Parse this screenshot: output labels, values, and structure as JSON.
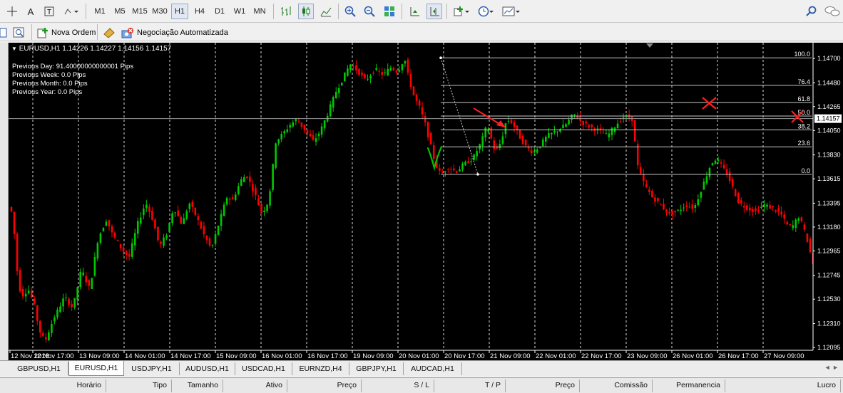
{
  "toolbar": {
    "timeframes": [
      "M1",
      "M5",
      "M15",
      "M30",
      "H1",
      "H4",
      "D1",
      "W1",
      "MN"
    ],
    "active_timeframe": "H1",
    "new_order_label": "Nova Ordem",
    "auto_trading_label": "Negociação Automatizada"
  },
  "chart": {
    "header": "EURUSD,H1  1.14226 1.14227 1.14156 1.14157",
    "info_lines": [
      "Previous Day: 91.40000000000001 Pips",
      "Previous Week: 0.0 Pips",
      "Previous Month: 0.0 Pips",
      "Previous Year: 0.0 Pips"
    ],
    "current_price": "1.14157"
  },
  "chart_data": {
    "type": "candlestick",
    "symbol": "EURUSD",
    "timeframe": "H1",
    "ohlc_current": {
      "open": 1.14226,
      "high": 1.14227,
      "low": 1.14156,
      "close": 1.14157
    },
    "y_ticks": [
      "1.14700",
      "1.14480",
      "1.14265",
      "1.14050",
      "1.13830",
      "1.13615",
      "1.13395",
      "1.13180",
      "1.12965",
      "1.12745",
      "1.12530",
      "1.12310",
      "1.12095"
    ],
    "ylim": [
      1.12095,
      1.147
    ],
    "x_ticks": [
      "12 Nov 2018",
      "12 Nov 17:00",
      "13 Nov 09:00",
      "14 Nov 01:00",
      "14 Nov 17:00",
      "15 Nov 09:00",
      "16 Nov 01:00",
      "16 Nov 17:00",
      "19 Nov 09:00",
      "20 Nov 01:00",
      "20 Nov 17:00",
      "21 Nov 09:00",
      "22 Nov 01:00",
      "22 Nov 17:00",
      "23 Nov 09:00",
      "26 Nov 01:00",
      "26 Nov 17:00",
      "27 Nov 09:00"
    ],
    "fibonacci": [
      {
        "level": "100.0",
        "price": 1.14705
      },
      {
        "level": "76.4",
        "price": 1.14457
      },
      {
        "level": "61.8",
        "price": 1.14303
      },
      {
        "level": "50.0",
        "price": 1.1418
      },
      {
        "level": "38.2",
        "price": 1.14056
      },
      {
        "level": "23.6",
        "price": 1.13903
      },
      {
        "level": "0.0",
        "price": 1.13655
      }
    ],
    "path": [
      [
        0,
        1.1336
      ],
      [
        3,
        1.133
      ],
      [
        6,
        1.128
      ],
      [
        9,
        1.1255
      ],
      [
        14,
        1.1262
      ],
      [
        18,
        1.125
      ],
      [
        22,
        1.1225
      ],
      [
        26,
        1.1215
      ],
      [
        32,
        1.1235
      ],
      [
        40,
        1.1255
      ],
      [
        46,
        1.1245
      ],
      [
        52,
        1.128
      ],
      [
        58,
        1.1262
      ],
      [
        64,
        1.1308
      ],
      [
        70,
        1.1325
      ],
      [
        74,
        1.1312
      ],
      [
        80,
        1.13
      ],
      [
        86,
        1.129
      ],
      [
        92,
        1.132
      ],
      [
        98,
        1.134
      ],
      [
        103,
        1.1325
      ],
      [
        108,
        1.13
      ],
      [
        113,
        1.1312
      ],
      [
        118,
        1.1336
      ],
      [
        124,
        1.132
      ],
      [
        129,
        1.134
      ],
      [
        134,
        1.1328
      ],
      [
        140,
        1.131
      ],
      [
        145,
        1.1298
      ],
      [
        150,
        1.132
      ],
      [
        156,
        1.1345
      ],
      [
        160,
        1.1342
      ],
      [
        166,
        1.136
      ],
      [
        170,
        1.1365
      ],
      [
        176,
        1.1348
      ],
      [
        181,
        1.133
      ],
      [
        186,
        1.1342
      ],
      [
        191,
        1.1395
      ],
      [
        196,
        1.1402
      ],
      [
        201,
        1.141
      ],
      [
        206,
        1.1415
      ],
      [
        212,
        1.1405
      ],
      [
        218,
        1.1395
      ],
      [
        223,
        1.1405
      ],
      [
        228,
        1.142
      ],
      [
        234,
        1.144
      ],
      [
        239,
        1.1452
      ],
      [
        244,
        1.1465
      ],
      [
        250,
        1.1458
      ],
      [
        255,
        1.145
      ],
      [
        262,
        1.146
      ],
      [
        268,
        1.1455
      ],
      [
        273,
        1.1462
      ],
      [
        278,
        1.1458
      ],
      [
        283,
        1.147
      ],
      [
        286,
        1.1452
      ],
      [
        290,
        1.1435
      ],
      [
        294,
        1.1425
      ],
      [
        298,
        1.141
      ],
      [
        302,
        1.139
      ],
      [
        305,
        1.1375
      ],
      [
        309,
        1.1365
      ],
      [
        314,
        1.1372
      ],
      [
        320,
        1.1368
      ],
      [
        326,
        1.1375
      ],
      [
        332,
        1.138
      ],
      [
        338,
        1.1395
      ],
      [
        342,
        1.141
      ],
      [
        348,
        1.1385
      ],
      [
        352,
        1.1395
      ],
      [
        356,
        1.1415
      ],
      [
        360,
        1.1412
      ],
      [
        365,
        1.14
      ],
      [
        370,
        1.139
      ],
      [
        375,
        1.1385
      ],
      [
        380,
        1.1392
      ],
      [
        385,
        1.14
      ],
      [
        392,
        1.1405
      ],
      [
        398,
        1.141
      ],
      [
        404,
        1.142
      ],
      [
        410,
        1.1412
      ],
      [
        416,
        1.1408
      ],
      [
        422,
        1.1405
      ],
      [
        428,
        1.14
      ],
      [
        434,
        1.141
      ],
      [
        440,
        1.1418
      ],
      [
        446,
        1.1415
      ],
      [
        448,
        1.139
      ],
      [
        450,
        1.137
      ],
      [
        455,
        1.1355
      ],
      [
        460,
        1.1345
      ],
      [
        466,
        1.1338
      ],
      [
        472,
        1.133
      ],
      [
        478,
        1.1332
      ],
      [
        484,
        1.1338
      ],
      [
        490,
        1.1335
      ],
      [
        496,
        1.1355
      ],
      [
        502,
        1.1375
      ],
      [
        506,
        1.138
      ],
      [
        510,
        1.1372
      ],
      [
        514,
        1.1365
      ],
      [
        518,
        1.1352
      ],
      [
        522,
        1.134
      ],
      [
        528,
        1.1335
      ],
      [
        534,
        1.1332
      ],
      [
        540,
        1.1338
      ],
      [
        546,
        1.1335
      ],
      [
        552,
        1.133
      ],
      [
        556,
        1.132
      ],
      [
        560,
        1.1318
      ],
      [
        565,
        1.1328
      ],
      [
        570,
        1.131
      ],
      [
        575,
        1.1285
      ]
    ],
    "annotations": [
      {
        "type": "checkmark",
        "color": "#00c000"
      },
      {
        "type": "arrow",
        "color": "#ff2020"
      },
      {
        "type": "cross",
        "color": "#ff2020"
      },
      {
        "type": "cross",
        "color": "#ff2020"
      }
    ]
  },
  "symbol_tabs": [
    "GBPUSD,H1",
    "EURUSD,H1",
    "USDJPY,H1",
    "AUDUSD,H1",
    "USDCAD,H1",
    "EURNZD,H4",
    "GBPJPY,H1",
    "AUDCAD,H1"
  ],
  "active_tab": "EURUSD,H1",
  "terminal_columns": [
    "Horário",
    "Tipo",
    "Tamanho",
    "Ativo",
    "Preço",
    "S / L",
    "T / P",
    "Preço",
    "Comissão",
    "Permanencia",
    "Lucro"
  ],
  "colors": {
    "bull": "#00c800",
    "bear": "#ff0000",
    "background": "#000000",
    "grid": "#ffffff"
  }
}
